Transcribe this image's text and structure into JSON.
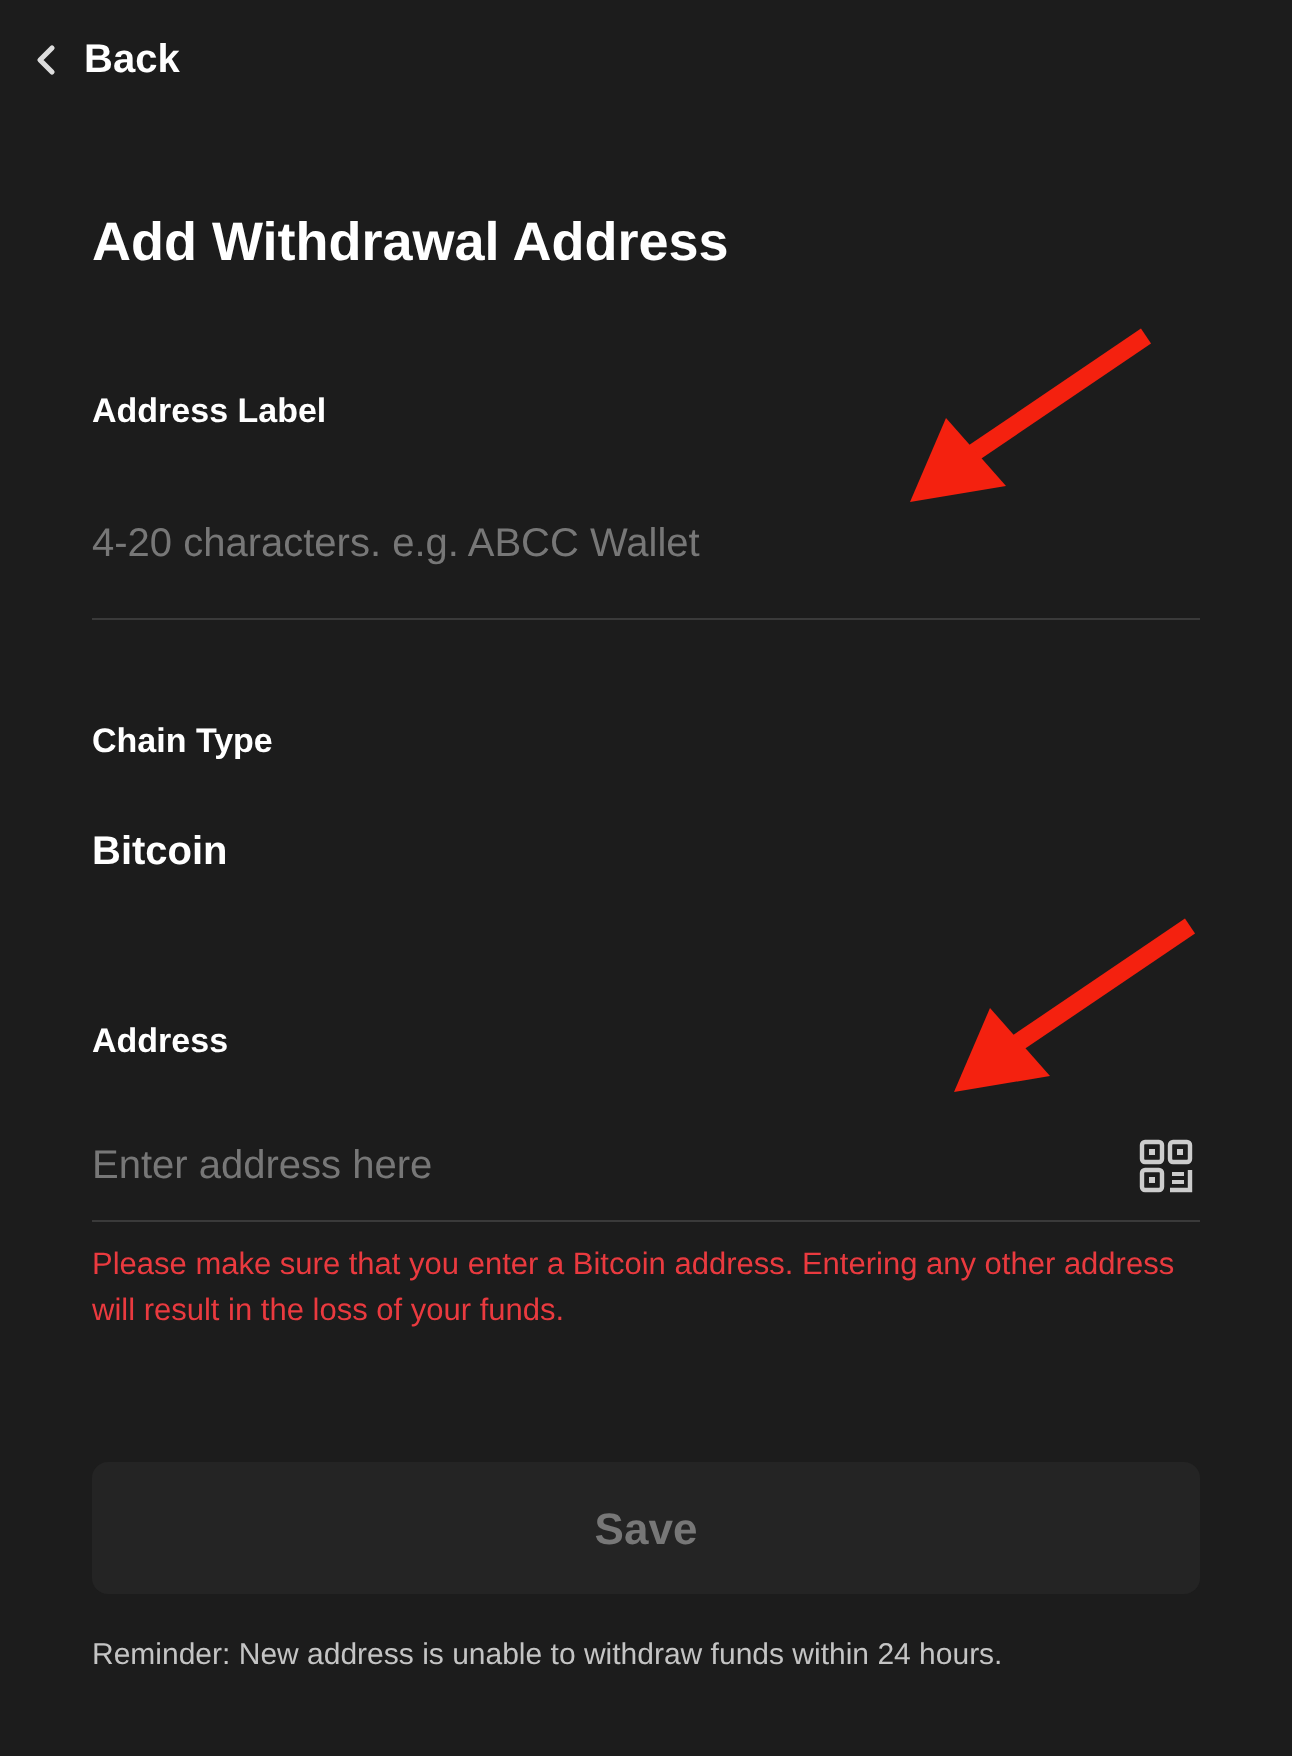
{
  "back": {
    "label": "Back"
  },
  "title": "Add Withdrawal Address",
  "fields": [
    {
      "kind": "text-input",
      "label": "Address Label",
      "placeholder": "4-20 characters. e.g. ABCC Wallet",
      "annotated": true
    },
    {
      "kind": "display",
      "label": "Chain Type",
      "value": "Bitcoin",
      "annotated": false
    },
    {
      "kind": "address-input",
      "label": "Address",
      "placeholder": "Enter address here",
      "warning": "Please make sure that you enter a Bitcoin address. Entering any other address will result in the loss of your funds.",
      "annotated": true
    }
  ],
  "save_button": {
    "label": "Save",
    "disabled": true
  },
  "reminder": "Reminder: New address is unable to withdraw funds within 24 hours."
}
